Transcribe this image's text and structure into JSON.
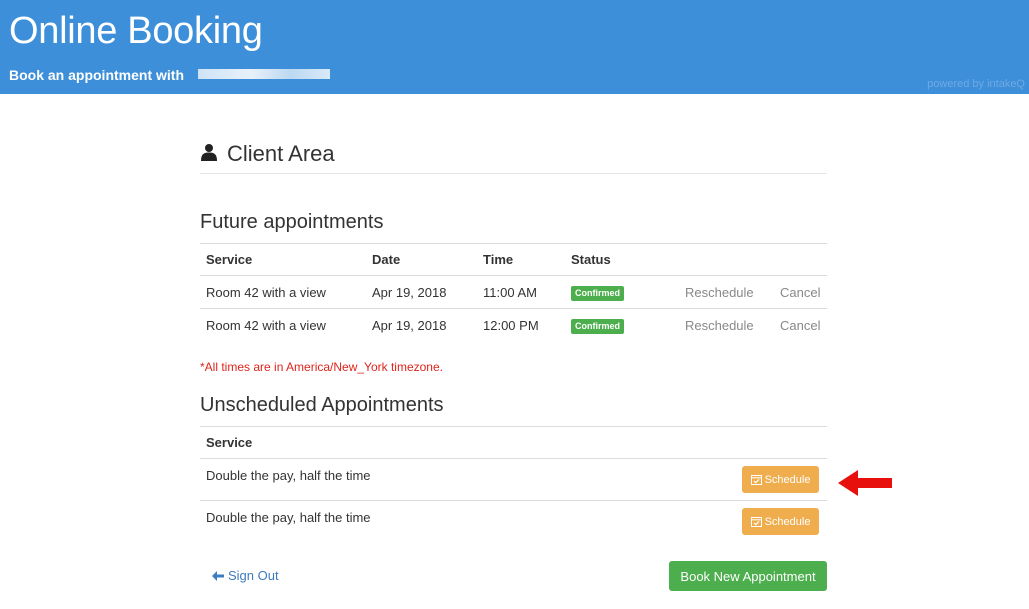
{
  "header": {
    "title": "Online Booking",
    "subtitle": "Book an appointment with",
    "powered_by": "powered by intakeQ",
    "brand_color": "#3d8fd9"
  },
  "client_area": {
    "title": "Client Area",
    "icon": "user-icon"
  },
  "future": {
    "title": "Future appointments",
    "columns": [
      "Service",
      "Date",
      "Time",
      "Status"
    ],
    "rows": [
      {
        "service": "Room 42 with a view",
        "date": "Apr 19, 2018",
        "time": "11:00 AM",
        "status": "Confirmed",
        "reschedule": "Reschedule",
        "cancel": "Cancel"
      },
      {
        "service": "Room 42 with a view",
        "date": "Apr 19, 2018",
        "time": "12:00 PM",
        "status": "Confirmed",
        "reschedule": "Reschedule",
        "cancel": "Cancel"
      }
    ],
    "timezone_note": "*All times are in America/New_York timezone."
  },
  "unscheduled": {
    "title": "Unscheduled Appointments",
    "columns": [
      "Service"
    ],
    "rows": [
      {
        "service": "Double the pay, half the time",
        "action": "Schedule"
      },
      {
        "service": "Double the pay, half the time",
        "action": "Schedule"
      }
    ]
  },
  "footer": {
    "sign_out": "Sign Out",
    "book_new": "Book New Appointment"
  },
  "colors": {
    "success": "#4cae4c",
    "warning": "#f0ad4e",
    "danger": "#e0241c",
    "link": "#3d7cc0"
  }
}
